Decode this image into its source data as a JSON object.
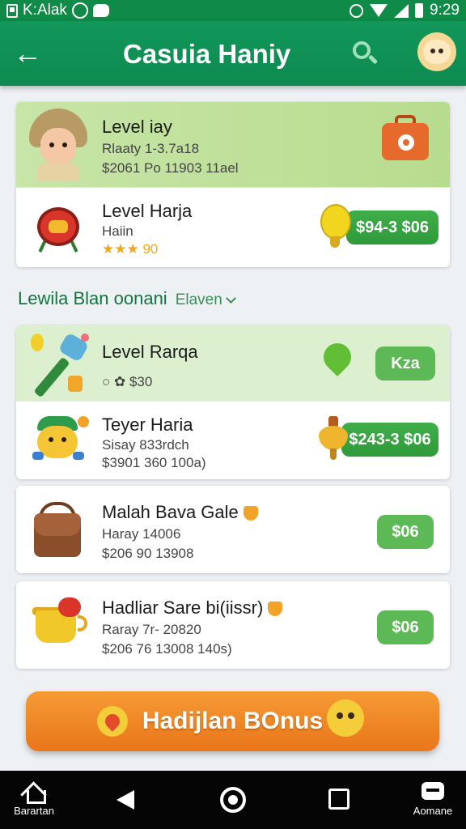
{
  "status_bar": {
    "app_label": "K:Alak",
    "time": "9:29"
  },
  "app_bar": {
    "title": "Casuia Haniy"
  },
  "featured_card": {
    "rows": [
      {
        "title": "Level iay",
        "line1": "Rlaaty 1-3.7a18",
        "line2": "$2061  Po  11903  11ael"
      },
      {
        "title": "Level Harja",
        "line1": "Haiin",
        "rating_text": "★★★ 90",
        "price": "$94-3 $06"
      }
    ]
  },
  "section": {
    "title": "Lewila Blan oonani",
    "filter_label": "Elaven"
  },
  "list_card_1": {
    "rows": [
      {
        "title": "Level Rarqa",
        "line1": "○  ✿ $30",
        "button": "Kza"
      },
      {
        "title": "Teyer Haria",
        "line1": "Sisay 833rdch",
        "line2": "$3901  360  100a)",
        "price": "$243-3 $06"
      }
    ]
  },
  "list_card_2": {
    "rows": [
      {
        "title": "Malah Bava Gale",
        "line1": "Haray 14006",
        "line2": "$206  90  13908",
        "button": "$06"
      }
    ]
  },
  "list_card_3": {
    "rows": [
      {
        "title": "Hadliar Sare bi(iissr)",
        "line1": "Raray 7r- 20820",
        "line2": "$206  76  13008  140s)",
        "button": "$06"
      }
    ]
  },
  "bonus": {
    "label": "Hadijlan BOnus"
  },
  "bottom_nav": {
    "home_label": "Barartan",
    "store_label": "Aomane"
  },
  "colors": {
    "primary": "#0f8a47",
    "accent": "#2e9a3a",
    "bonus": "#ee8124"
  },
  "icons": [
    "back-arrow-icon",
    "search-icon",
    "profile-icon",
    "bag-icon",
    "drum-icon",
    "balloon-icon",
    "hammer-icon",
    "heart-icon",
    "buddy-icon",
    "top-icon",
    "satchel-icon",
    "pot-icon",
    "home-icon",
    "store-icon"
  ]
}
